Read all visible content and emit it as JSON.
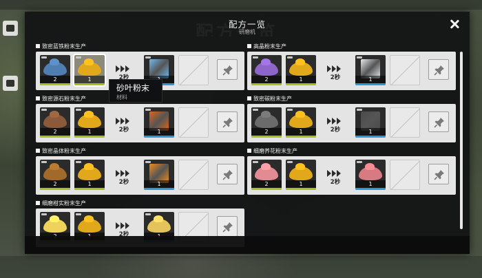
{
  "dialog": {
    "title": "配方一览",
    "subtitle": "研磨机",
    "close_icon": "close-icon"
  },
  "colors": {
    "input_bar": "#a6c11d",
    "output_bar": "#2d98d6",
    "card_bg": "#e4e4e4",
    "dialog_bg": "#141516"
  },
  "tooltip": {
    "name": "砂叶粉末",
    "type": "材料"
  },
  "recipes": [
    {
      "title": "致密蓝铁粉末生产",
      "inputs": [
        {
          "icon": "blue-iron-powder-icon",
          "count": "2",
          "color": "#4f7fb0"
        },
        {
          "icon": "sandleaf-powder-icon",
          "count": "1",
          "color": "#e2a81b"
        }
      ],
      "time": "2秒",
      "output": {
        "icon": "blue-iron-cube-icon",
        "count": "1",
        "color": "#6fb9f0"
      }
    },
    {
      "title": "高晶粉末生产",
      "inputs": [
        {
          "icon": "amethyst-powder-icon",
          "count": "2",
          "color": "#8e66c9"
        },
        {
          "icon": "sandleaf-powder-icon",
          "count": "1",
          "color": "#e2a81b"
        }
      ],
      "time": "2秒",
      "output": {
        "icon": "crystal-cube-icon",
        "count": "1",
        "color": "#e7e9ee"
      }
    },
    {
      "title": "致密源石粉末生产",
      "inputs": [
        {
          "icon": "originium-powder-icon",
          "count": "2",
          "color": "#8a5a3a"
        },
        {
          "icon": "sandleaf-powder-icon",
          "count": "1",
          "color": "#e2a81b"
        }
      ],
      "time": "2秒",
      "output": {
        "icon": "originium-cube-icon",
        "count": "1",
        "color": "#e0641c"
      }
    },
    {
      "title": "致密碳粉末生产",
      "inputs": [
        {
          "icon": "carbon-powder-icon",
          "count": "2",
          "color": "#6b6b6b"
        },
        {
          "icon": "sandleaf-powder-icon",
          "count": "1",
          "color": "#e2a81b"
        }
      ],
      "time": "2秒",
      "output": {
        "icon": "carbon-cube-icon",
        "count": "1",
        "color": "#4a4a4a"
      }
    },
    {
      "title": "致密晶体粉末生产",
      "inputs": [
        {
          "icon": "crystal-powder-icon",
          "count": "2",
          "color": "#a26a2a"
        },
        {
          "icon": "sandleaf-powder-icon",
          "count": "1",
          "color": "#e2a81b"
        }
      ],
      "time": "2秒",
      "output": {
        "icon": "crystal-ore-cube-icon",
        "count": "1",
        "color": "#f28a1c"
      }
    },
    {
      "title": "细磨荞花粉末生产",
      "inputs": [
        {
          "icon": "buckflower-powder-icon",
          "count": "2",
          "color": "#e28b92"
        },
        {
          "icon": "sandleaf-powder-icon",
          "count": "1",
          "color": "#e2a81b"
        }
      ],
      "time": "2秒",
      "output": {
        "icon": "buckflower-fine-powder-icon",
        "count": "1",
        "color": "#d87a82"
      }
    },
    {
      "title": "细磨柑实粉末生产",
      "inputs": [
        {
          "icon": "citrome-powder-icon",
          "count": "2",
          "color": "#efd25a"
        },
        {
          "icon": "sandleaf-powder-icon",
          "count": "1",
          "color": "#e2a81b"
        }
      ],
      "time": "2秒",
      "output": {
        "icon": "citrome-fine-powder-icon",
        "count": "1",
        "color": "#e4c35a"
      }
    }
  ],
  "pin_icon": "pin-icon"
}
